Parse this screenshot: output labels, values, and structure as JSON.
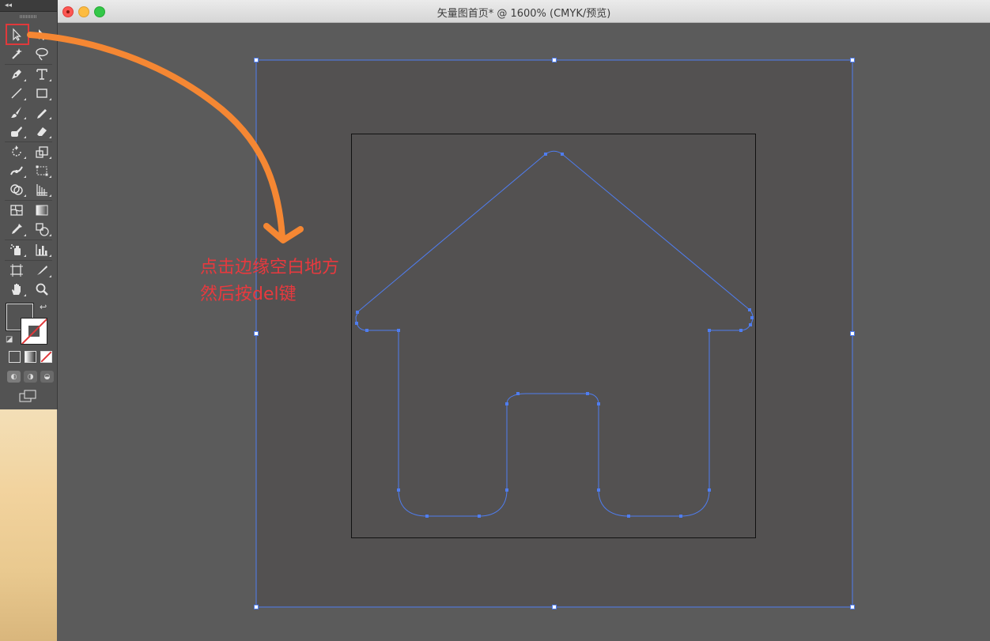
{
  "window": {
    "title": "矢量图首页* @ 1600% (CMYK/预览)"
  },
  "tools": [
    {
      "name": "selection-tool",
      "icon": "selection-arrow-icon"
    },
    {
      "name": "direct-selection-tool",
      "icon": "direct-selection-arrow-icon"
    },
    {
      "name": "magic-wand-tool",
      "icon": "magic-wand-icon"
    },
    {
      "name": "lasso-tool",
      "icon": "lasso-icon"
    },
    {
      "name": "pen-tool",
      "icon": "pen-icon"
    },
    {
      "name": "type-tool",
      "icon": "type-icon",
      "glyph": "T"
    },
    {
      "name": "line-segment-tool",
      "icon": "line-icon"
    },
    {
      "name": "rectangle-tool",
      "icon": "rectangle-icon"
    },
    {
      "name": "paintbrush-tool",
      "icon": "brush-icon"
    },
    {
      "name": "pencil-tool",
      "icon": "pencil-icon"
    },
    {
      "name": "blob-brush-tool",
      "icon": "blob-brush-icon"
    },
    {
      "name": "eraser-tool",
      "icon": "eraser-icon"
    },
    {
      "name": "rotate-tool",
      "icon": "rotate-icon"
    },
    {
      "name": "scale-tool",
      "icon": "scale-icon"
    },
    {
      "name": "width-tool",
      "icon": "width-icon"
    },
    {
      "name": "free-transform-tool",
      "icon": "free-transform-icon"
    },
    {
      "name": "shape-builder-tool",
      "icon": "shape-builder-icon"
    },
    {
      "name": "perspective-grid-tool",
      "icon": "perspective-grid-icon"
    },
    {
      "name": "mesh-tool",
      "icon": "mesh-icon"
    },
    {
      "name": "gradient-tool",
      "icon": "gradient-icon"
    },
    {
      "name": "eyedropper-tool",
      "icon": "eyedropper-icon"
    },
    {
      "name": "blend-tool",
      "icon": "blend-icon"
    },
    {
      "name": "symbol-sprayer-tool",
      "icon": "symbol-sprayer-icon"
    },
    {
      "name": "column-graph-tool",
      "icon": "column-graph-icon"
    },
    {
      "name": "artboard-tool",
      "icon": "artboard-icon"
    },
    {
      "name": "slice-tool",
      "icon": "slice-icon"
    },
    {
      "name": "hand-tool",
      "icon": "hand-icon"
    },
    {
      "name": "zoom-tool",
      "icon": "zoom-icon"
    }
  ],
  "annotation": {
    "line1": "点击边缘空白地方",
    "line2": "然后按del键",
    "color": "#e8393e"
  },
  "colors": {
    "selection_path": "#4f7df0",
    "arrow": "#f58733",
    "highlight_box": "#e0393b",
    "artboard": "#535151",
    "canvas": "#5b5b5b"
  }
}
